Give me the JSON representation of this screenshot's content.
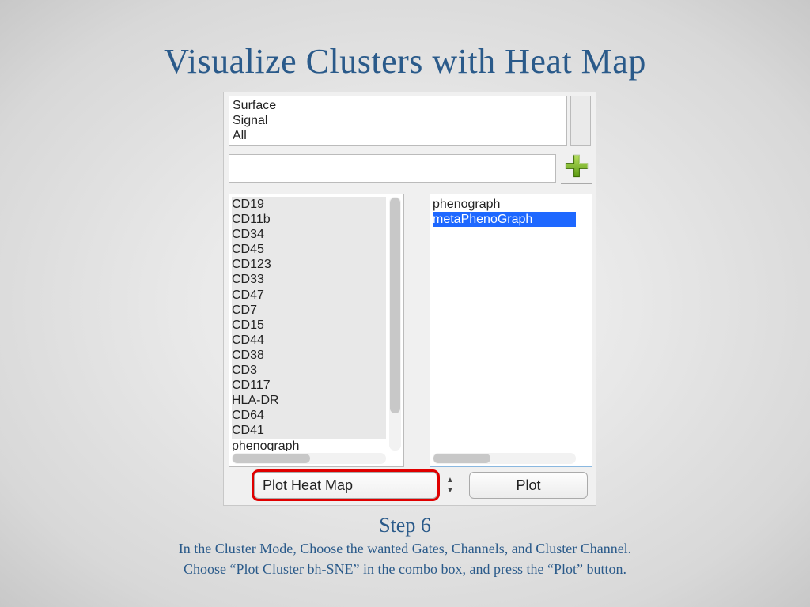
{
  "title": "Visualize Clusters with Heat Map",
  "top_list": [
    "Surface",
    "Signal",
    "All"
  ],
  "filter_value": "",
  "left_items": [
    {
      "label": "CD19",
      "selected": true
    },
    {
      "label": "CD11b",
      "selected": true
    },
    {
      "label": "CD34",
      "selected": true
    },
    {
      "label": "CD45",
      "selected": true
    },
    {
      "label": "CD123",
      "selected": true
    },
    {
      "label": "CD33",
      "selected": true
    },
    {
      "label": "CD47",
      "selected": true
    },
    {
      "label": "CD7",
      "selected": true
    },
    {
      "label": "CD15",
      "selected": true
    },
    {
      "label": "CD44",
      "selected": true
    },
    {
      "label": "CD38",
      "selected": true
    },
    {
      "label": "CD3",
      "selected": true
    },
    {
      "label": "CD117",
      "selected": true
    },
    {
      "label": "HLA-DR",
      "selected": true
    },
    {
      "label": "CD64",
      "selected": true
    },
    {
      "label": "CD41",
      "selected": true
    },
    {
      "label": "phenograph",
      "selected": false
    }
  ],
  "right_items": [
    {
      "label": "phenograph",
      "highlighted": false
    },
    {
      "label": "metaPhenoGraph",
      "highlighted": true
    }
  ],
  "combo_value": "Plot Heat Map",
  "plot_button": "Plot",
  "caption": {
    "step": "Step 6",
    "line1": "In the Cluster Mode, Choose the wanted Gates, Channels, and Cluster Channel.",
    "line2": "Choose “Plot Cluster bh-SNE” in the combo box, and press the “Plot” button."
  }
}
